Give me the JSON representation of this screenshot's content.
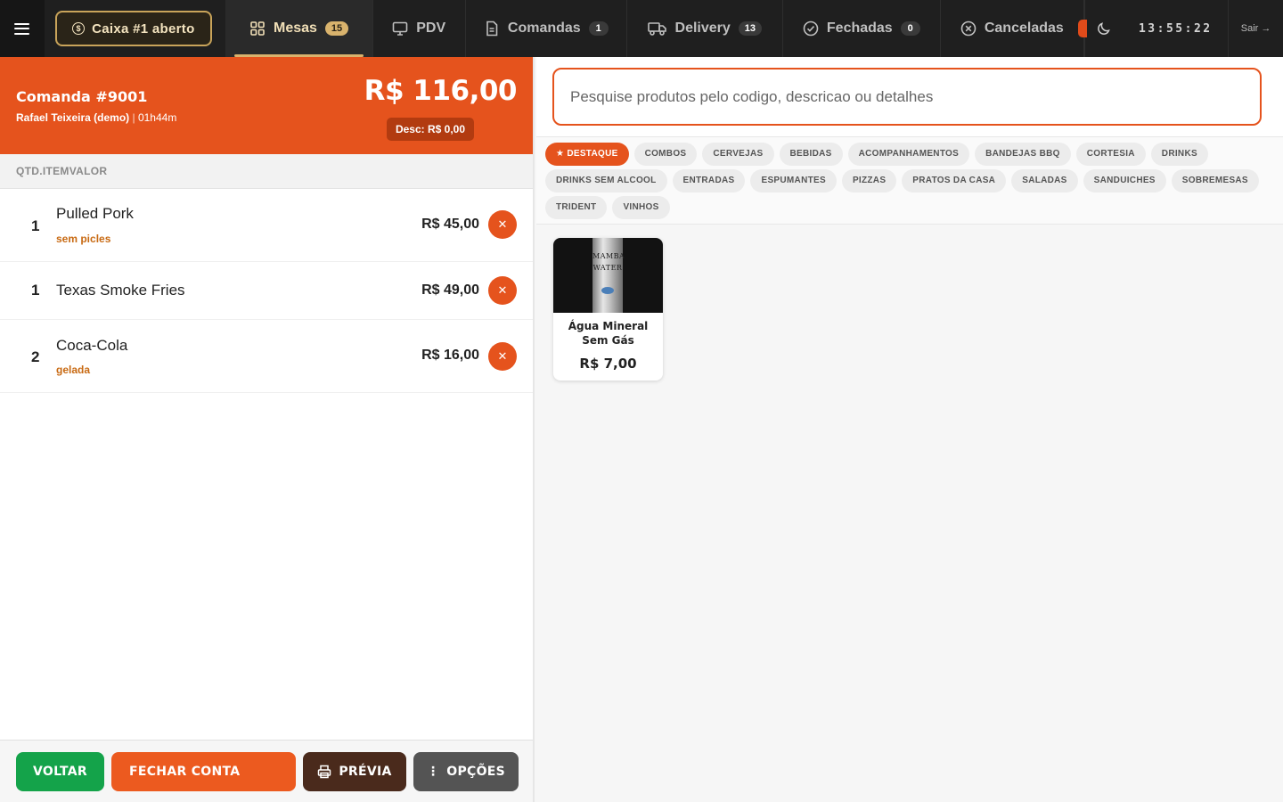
{
  "colors": {
    "accent": "#e5531d",
    "topbar": "#1f1f1f",
    "gold": "#d9b36d",
    "success": "#14a34a",
    "brown": "#4a2a1c",
    "gray": "#545454"
  },
  "topbar": {
    "caixa_label": "Caixa #1 aberto",
    "tabs": [
      {
        "label": "Mesas",
        "badge": "15",
        "icon": "grid-icon",
        "active": true
      },
      {
        "label": "PDV",
        "badge": "",
        "icon": "monitor-icon",
        "active": false
      },
      {
        "label": "Comandas",
        "badge": "1",
        "icon": "document-icon",
        "active": false
      },
      {
        "label": "Delivery",
        "badge": "13",
        "icon": "truck-icon",
        "active": false
      },
      {
        "label": "Fechadas",
        "badge": "0",
        "icon": "check-circle-icon",
        "active": false
      },
      {
        "label": "Canceladas",
        "badge": "",
        "icon": "x-circle-icon",
        "active": false
      }
    ],
    "clock": "13:55:22",
    "logout_label": "Sair"
  },
  "order": {
    "title": "Comanda #9001",
    "customer": "Rafael Teixeira (demo)",
    "elapsed": "01h44m",
    "total": "R$ 116,00",
    "discount": "Desc: R$ 0,00",
    "columns_header": "QTD.ITEMVALOR",
    "items": [
      {
        "qty": "1",
        "name": "Pulled Pork",
        "note": "sem picles",
        "value": "R$ 45,00"
      },
      {
        "qty": "1",
        "name": "Texas Smoke Fries",
        "note": "",
        "value": "R$ 49,00"
      },
      {
        "qty": "2",
        "name": "Coca-Cola",
        "note": "gelada",
        "value": "R$ 16,00"
      }
    ]
  },
  "footer": {
    "back_label": "VOLTAR",
    "close_label": "FECHAR CONTA",
    "preview_label": "PRÉVIA",
    "options_label": "OPÇÕES"
  },
  "search": {
    "placeholder": "Pesquise produtos pelo codigo, descricao ou detalhes"
  },
  "categories": [
    {
      "label": "★ DESTAQUE",
      "active": true
    },
    {
      "label": "COMBOS"
    },
    {
      "label": "CERVEJAS"
    },
    {
      "label": "BEBIDAS"
    },
    {
      "label": "ACOMPANHAMENTOS"
    },
    {
      "label": "BANDEJAS BBQ"
    },
    {
      "label": "CORTESIA"
    },
    {
      "label": "DRINKS"
    },
    {
      "label": "DRINKS SEM ALCOOL"
    },
    {
      "label": "ENTRADAS"
    },
    {
      "label": "ESPUMANTES"
    },
    {
      "label": "PIZZAS"
    },
    {
      "label": "PRATOS DA CASA"
    },
    {
      "label": "SALADAS"
    },
    {
      "label": "SANDUICHES"
    },
    {
      "label": "SOBREMESAS"
    },
    {
      "label": "TRIDENT"
    },
    {
      "label": "VINHOS"
    }
  ],
  "products": [
    {
      "name": "Água Mineral Sem Gás",
      "price": "R$ 7,00",
      "image_text": "MAMBA WATER"
    }
  ]
}
